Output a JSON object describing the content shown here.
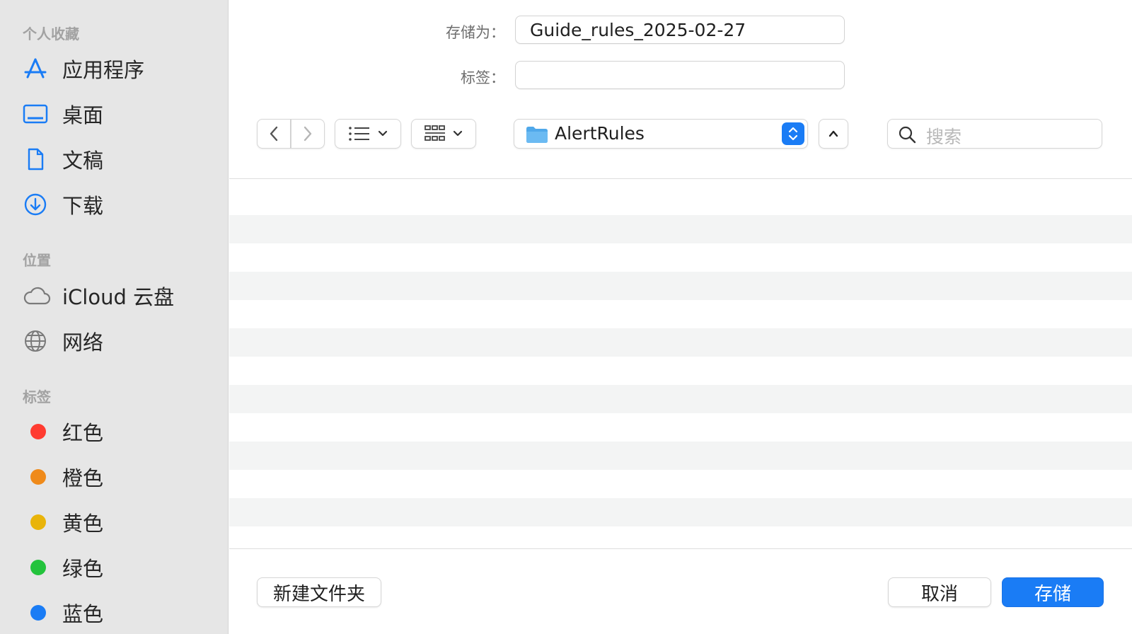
{
  "sidebar": {
    "favorites_title": "个人收藏",
    "favorites": [
      {
        "label": "应用程序",
        "icon": "app-store-icon"
      },
      {
        "label": "桌面",
        "icon": "desktop-icon"
      },
      {
        "label": "文稿",
        "icon": "document-icon"
      },
      {
        "label": "下载",
        "icon": "download-icon"
      }
    ],
    "locations_title": "位置",
    "locations": [
      {
        "label": "iCloud 云盘",
        "icon": "cloud-icon"
      },
      {
        "label": "网络",
        "icon": "globe-icon"
      }
    ],
    "tags_title": "标签",
    "tags": [
      {
        "label": "红色",
        "color": "#ff3b30"
      },
      {
        "label": "橙色",
        "color": "#ef8a1a"
      },
      {
        "label": "黄色",
        "color": "#e9b40a"
      },
      {
        "label": "绿色",
        "color": "#23c33c"
      },
      {
        "label": "蓝色",
        "color": "#1a7cf5"
      }
    ]
  },
  "form": {
    "save_as_label": "存储为：",
    "save_as_value": "Guide_rules_2025-02-27",
    "tags_label": "标签：",
    "tags_value": ""
  },
  "toolbar": {
    "back_icon": "chevron-left-icon",
    "forward_icon": "chevron-right-icon",
    "list_view_icon": "list-view-icon",
    "grid_view_icon": "grid-view-icon",
    "current_folder": "AlertRules",
    "search_placeholder": "搜索"
  },
  "footer": {
    "new_folder": "新建文件夹",
    "cancel": "取消",
    "save": "存储"
  },
  "colors": {
    "accent": "#1a7cf5",
    "sidebar_bg": "#e6e6e6"
  }
}
